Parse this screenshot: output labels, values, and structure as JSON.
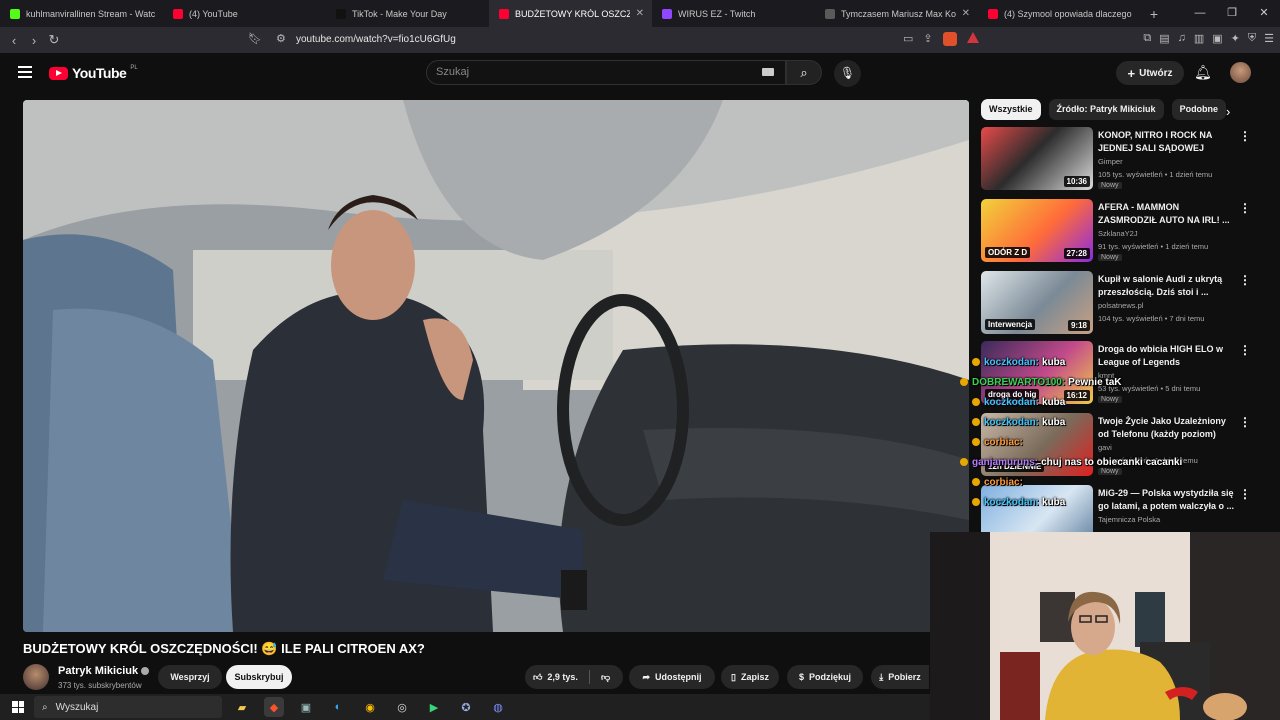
{
  "browser": {
    "tabs": [
      {
        "title": "kuhlmanvirallinen Stream - Watch Li",
        "color": "#53fc18",
        "active": false,
        "closable": false
      },
      {
        "title": "(4) YouTube",
        "color": "#ff0033",
        "active": false,
        "closable": false
      },
      {
        "title": "TikTok - Make Your Day",
        "color": "#111111",
        "active": false,
        "closable": false
      },
      {
        "title": "BUDŻETOWY KRÓL OSZCZĘD",
        "color": "#ff0033",
        "active": true,
        "closable": true
      },
      {
        "title": "WIRUS EZ - Twitch",
        "color": "#9146ff",
        "active": false,
        "closable": false
      },
      {
        "title": "Tymczasem Mariusz Max Koni",
        "color": "#5a5a5a",
        "active": false,
        "closable": true
      },
      {
        "title": "(4) Szymool opowiada dlaczego zos",
        "color": "#ff0033",
        "active": false,
        "closable": false
      }
    ],
    "new_tab": "+",
    "url": "youtube.com/watch?v=fio1cU6GfUg"
  },
  "youtube": {
    "logo_text": "YouTube",
    "logo_country": "PL",
    "search_placeholder": "Szukaj",
    "create_label": "Utwórz"
  },
  "video": {
    "title": "BUDŻETOWY KRÓL OSZCZĘDNOŚCI! 😅 ILE PALI CITROEN AX?",
    "channel": "Patryk Mikiciuk",
    "subscribers": "373 tys. subskrybentów",
    "support_label": "Wesprzyj",
    "subscribe_label": "Subskrybuj",
    "likes": "2,9 tys.",
    "share_label": "Udostępnij",
    "save_label": "Zapisz",
    "thanks_label": "Podziękuj",
    "download_label": "Pobierz"
  },
  "sidebar": {
    "chips": [
      "Wszystkie",
      "Źródło: Patryk Mikiciuk",
      "Podobne"
    ],
    "recommendations": [
      {
        "title": "KONOP, NITRO I ROCK NA JEDNEJ SALI SĄDOWEJ",
        "channel": "Gimper",
        "meta": "105 tys. wyświetleń • 1 dzień temu",
        "badge": "Nowy",
        "duration": "10:36",
        "overlay": ""
      },
      {
        "title": "AFERA - MAMMON ZASMRODZIŁ AUTO NA IRL! ...",
        "channel": "SzklanaY2J",
        "meta": "91 tys. wyświetleń • 1 dzień temu",
        "badge": "Nowy",
        "duration": "27:28",
        "overlay": "ODÓR Z D"
      },
      {
        "title": "Kupił w salonie Audi z ukrytą przeszłością. Dziś stoi i ...",
        "channel": "polsatnews.pl",
        "meta": "104 tys. wyświetleń • 7 dni temu",
        "badge": "",
        "duration": "9:18",
        "overlay": "Interwencja"
      },
      {
        "title": "Droga do wbicia HIGH ELO w League of Legends",
        "channel": "kmnt",
        "meta": "53 tys. wyświetleń • 5 dni temu",
        "badge": "Nowy",
        "duration": "16:12",
        "overlay": "droga do hig"
      },
      {
        "title": "Twoje Życie Jako Uzależniony od Telefonu (każdy poziom)",
        "channel": "gavi",
        "meta": "tys. wyświetleń • 1 dzień temu",
        "badge": "Nowy",
        "duration": "",
        "overlay": "12h DZIENNIE"
      },
      {
        "title": "MiG-29 — Polska wystydziła się go latami, a potem walczyła o ...",
        "channel": "Tajemnicza Polska",
        "meta": "",
        "badge": "",
        "duration": "",
        "overlay": ""
      }
    ]
  },
  "chat": [
    {
      "user": "koczkodan:",
      "msg": "kuba",
      "color": "#3ec6ff"
    },
    {
      "user": "DOBREWARTO100:",
      "msg": "Pewnie taK",
      "color": "#39d353"
    },
    {
      "user": "koczkodan:",
      "msg": "kuba",
      "color": "#3ec6ff"
    },
    {
      "user": "koczkodan:",
      "msg": "kuba",
      "color": "#3ec6ff"
    },
    {
      "user": "corbiac:",
      "msg": "",
      "color": "#ff9a3c"
    },
    {
      "user": "ganjamuruns:",
      "msg": "chuj nas to obiecanki cacanki",
      "color": "#b57bff"
    },
    {
      "user": "corbiac:",
      "msg": "",
      "color": "#ff9a3c"
    },
    {
      "user": "koczkodan:",
      "msg": "kuba",
      "color": "#3ec6ff"
    }
  ],
  "taskbar": {
    "search_label": "Wyszukaj"
  }
}
